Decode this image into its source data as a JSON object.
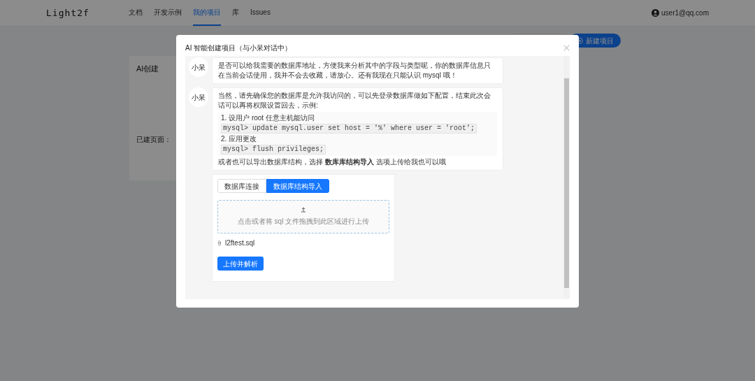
{
  "header": {
    "logo": "Light2f",
    "nav": [
      {
        "label": "文档",
        "selected": false
      },
      {
        "label": "开发示例",
        "selected": false
      },
      {
        "label": "我的项目",
        "selected": true
      },
      {
        "label": "库",
        "selected": false
      },
      {
        "label": "Issues",
        "selected": false
      }
    ],
    "user": "user1@qq.com"
  },
  "background": {
    "new_button": "新建项目",
    "card_title": "AI创建",
    "pages_label": "已建页面："
  },
  "modal": {
    "title": "AI 智能创建项目（与小呆对话中）",
    "messages": [
      {
        "avatar": "小呆",
        "paragraphs": [
          "是否可以给我需要的数据库地址，方便我来分析其中的字段与类型呢，你的数据库信息只在当前会话使用，我并不会去收藏，请放心。还有我现在只能认识 mysql 哦！"
        ]
      },
      {
        "avatar": "小呆",
        "paragraphs": [
          "当然，请先确保您的数据库是允许我访问的，可以先登录数据库做如下配置，结束此次会话可以再将权限设置回去，示例:"
        ],
        "steps": [
          {
            "label": "1. 设用户 root 任意主机能访问",
            "code": "mysql> update mysql.user set host = '%' where user = 'root';"
          },
          {
            "label": "2. 应用更改",
            "code": "mysql> flush privileges;"
          }
        ],
        "footer": "或者也可以导出数据库结构，选择 **数库库结构导入** 选项上传给我也可以哦"
      }
    ],
    "upload": {
      "tabs": [
        {
          "label": "数据库连接",
          "selected": false
        },
        {
          "label": "数据库结构导入",
          "selected": true
        }
      ],
      "dropzone": "点击或者将 sql 文件拖拽到此区域进行上传",
      "file": "l2ftest.sql",
      "submit": "上传并解析"
    }
  }
}
